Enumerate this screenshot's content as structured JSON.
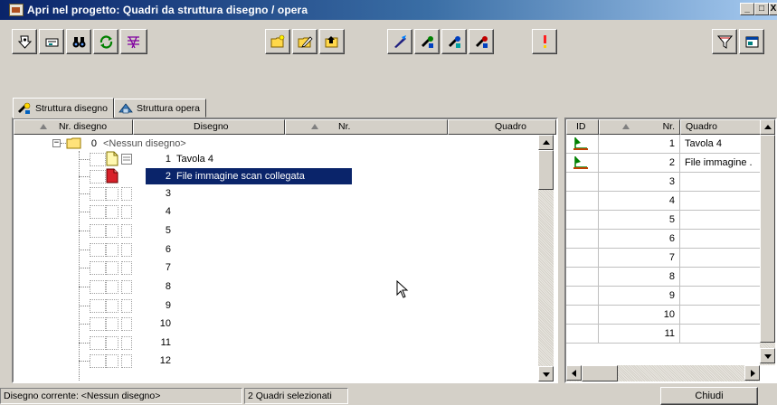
{
  "window": {
    "title": "Apri nel progetto: Quadri da struttura disegno / opera",
    "min_glyph": "_",
    "max_glyph": "□",
    "close_glyph": "X"
  },
  "toolbar": {
    "buttons": [
      "open-project-icon",
      "display-icon",
      "binoculars-icon",
      "refresh-icon",
      "structure-icon",
      "new-folder-icon",
      "edit-folder-icon",
      "folder-up-icon",
      "draw-icon",
      "arrange-icon",
      "sort-icon",
      "mark-icon",
      "info-icon",
      "filter-icon",
      "settings-icon"
    ]
  },
  "tabs": [
    {
      "label": "Struttura disegno",
      "icon": "drawing-structure-icon",
      "active": true
    },
    {
      "label": "Struttura opera",
      "icon": "work-structure-icon",
      "active": false
    }
  ],
  "left_table": {
    "columns": [
      "Nr. disegno",
      "Disegno",
      "Nr.",
      "Quadro"
    ],
    "root": {
      "number": "0",
      "label": "<Nessun disegno>"
    },
    "rows": [
      {
        "number": "1",
        "label": "Tavola 4",
        "selected": false
      },
      {
        "number": "2",
        "label": "File immagine scan collegata",
        "selected": true
      },
      {
        "number": "3",
        "label": ""
      },
      {
        "number": "4",
        "label": ""
      },
      {
        "number": "5",
        "label": ""
      },
      {
        "number": "6",
        "label": ""
      },
      {
        "number": "7",
        "label": ""
      },
      {
        "number": "8",
        "label": ""
      },
      {
        "number": "9",
        "label": ""
      },
      {
        "number": "10",
        "label": ""
      },
      {
        "number": "11",
        "label": ""
      },
      {
        "number": "12",
        "label": ""
      }
    ]
  },
  "right_table": {
    "columns": [
      "ID",
      "Nr.",
      "Quadro"
    ],
    "rows": [
      {
        "nr": "1",
        "quadro": "Tavola 4",
        "has_icon": true
      },
      {
        "nr": "2",
        "quadro": "File immagine .",
        "has_icon": true
      },
      {
        "nr": "3",
        "quadro": ""
      },
      {
        "nr": "4",
        "quadro": ""
      },
      {
        "nr": "5",
        "quadro": ""
      },
      {
        "nr": "6",
        "quadro": ""
      },
      {
        "nr": "7",
        "quadro": ""
      },
      {
        "nr": "8",
        "quadro": ""
      },
      {
        "nr": "9",
        "quadro": ""
      },
      {
        "nr": "10",
        "quadro": ""
      },
      {
        "nr": "11",
        "quadro": ""
      }
    ]
  },
  "status": {
    "current_drawing": "Disegno corrente: <Nessun disegno>",
    "selected_count": "2 Quadri selezionati",
    "close_label": "Chiudi"
  },
  "colors": {
    "title_start": "#0a246a",
    "title_end": "#a6caf0",
    "selection": "#0a246a",
    "face": "#d4d0c8"
  }
}
